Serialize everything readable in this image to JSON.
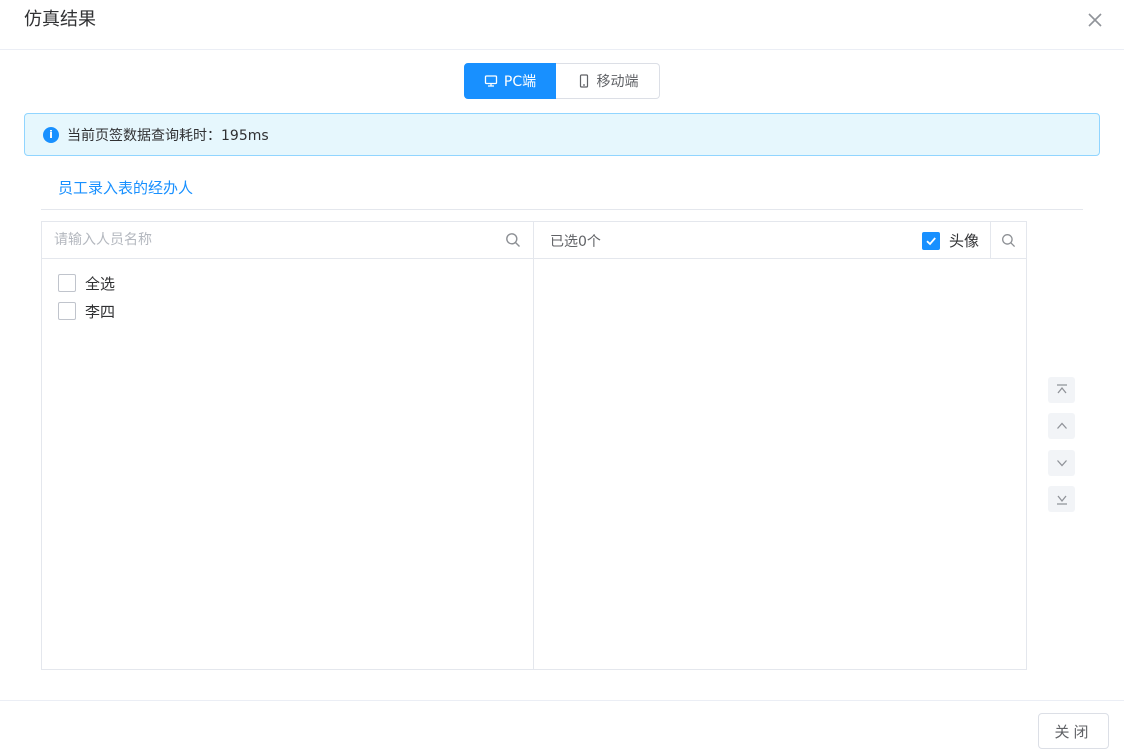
{
  "dialog": {
    "title": "仿真结果",
    "close_icon": "close-icon"
  },
  "device_tabs": [
    {
      "label": "PC端",
      "icon": "monitor-icon",
      "active": true
    },
    {
      "label": "移动端",
      "icon": "mobile-icon",
      "active": false
    }
  ],
  "alert": {
    "icon": "info-icon",
    "glyph": "i",
    "text": "当前页签数据查询耗时：195ms"
  },
  "sub_tab": {
    "label": "员工录入表的经办人"
  },
  "left_panel": {
    "search_placeholder": "请输入人员名称",
    "search_icon": "search-icon",
    "items": [
      {
        "label": "全选",
        "checked": false
      },
      {
        "label": "李四",
        "checked": false
      }
    ]
  },
  "right_panel": {
    "selected_count": "已选0个",
    "avatar_label": "头像",
    "avatar_checked": true,
    "search_icon": "search-icon"
  },
  "order_buttons": [
    {
      "icon": "move-top-icon"
    },
    {
      "icon": "move-up-icon"
    },
    {
      "icon": "move-down-icon"
    },
    {
      "icon": "move-bottom-icon"
    }
  ],
  "footer": {
    "close_label": "关闭"
  },
  "colors": {
    "primary": "#1890ff",
    "alert_bg": "#e6f7fd",
    "border": "#e4e7ed"
  }
}
